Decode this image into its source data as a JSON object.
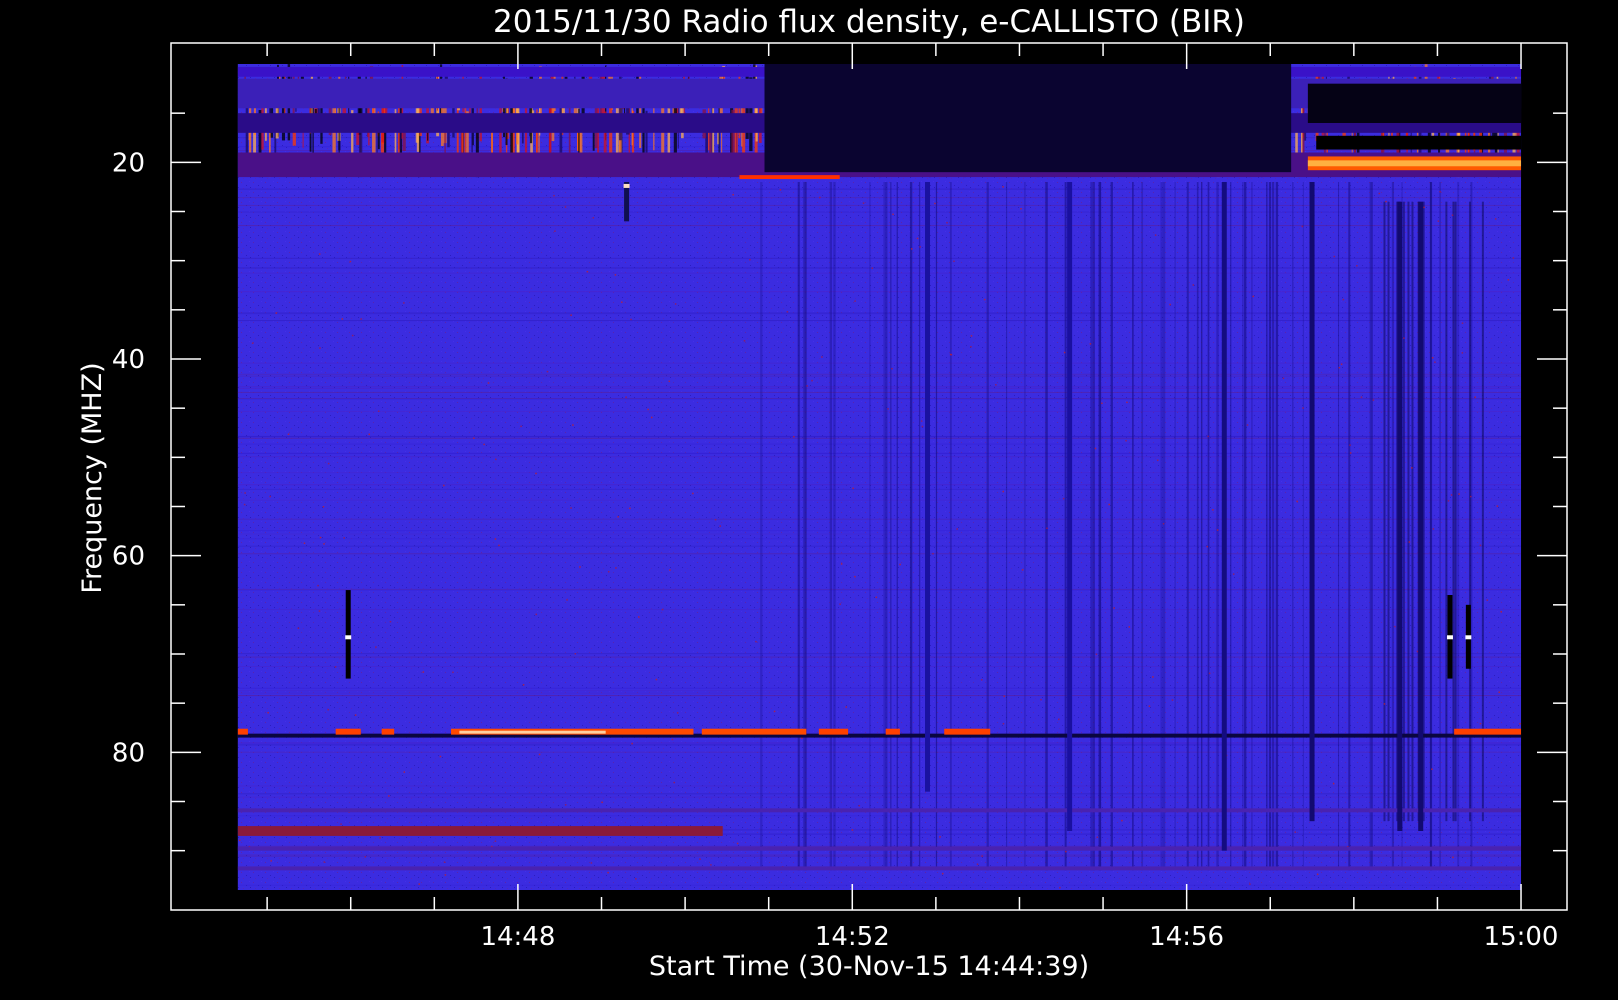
{
  "chart_data": {
    "type": "heatmap",
    "title": "2015/11/30  Radio flux density, e-CALLISTO (BIR)",
    "xlabel": "Start Time (30-Nov-15 14:44:39)",
    "ylabel": "Frequency (MHZ)",
    "x_tick_labels": [
      "14:48",
      "14:52",
      "14:56",
      "15:00"
    ],
    "x_tick_minutes": [
      3.35,
      7.35,
      11.35,
      15.35
    ],
    "x_range_minutes": [
      -0.8,
      15.9
    ],
    "data_x_range_minutes": [
      0,
      15.35
    ],
    "y_tick_values": [
      20,
      40,
      60,
      80
    ],
    "y_range": [
      10,
      94
    ],
    "data_y_range": [
      10,
      94
    ],
    "y_inverted": true,
    "colormap": "blue-red-yellow-white",
    "features": [
      {
        "kind": "hband",
        "f1": 10.3,
        "f2": 11.3,
        "t1": 0,
        "t2": 15.35,
        "color": "#3a12c8"
      },
      {
        "kind": "hband",
        "f1": 11.5,
        "f2": 14.5,
        "t1": 0,
        "t2": 15.35,
        "color": "#3b20b8"
      },
      {
        "kind": "hband",
        "f1": 15.0,
        "f2": 17.0,
        "t1": 0,
        "t2": 15.35,
        "color": "#2a0c88"
      },
      {
        "kind": "hband",
        "f1": 19.0,
        "f2": 21.5,
        "t1": 0,
        "t2": 15.35,
        "color": "#4a1088"
      },
      {
        "kind": "hband",
        "f1": 10.0,
        "f2": 21.0,
        "t1": 6.3,
        "t2": 12.6,
        "color": "#0a0430"
      },
      {
        "kind": "hband",
        "f1": 12.0,
        "f2": 16.0,
        "t1": 12.8,
        "t2": 15.35,
        "color": "#050215"
      },
      {
        "kind": "hband",
        "f1": 17.3,
        "f2": 18.7,
        "t1": 12.9,
        "t2": 15.35,
        "color": "#000000"
      },
      {
        "kind": "hband",
        "f1": 19.4,
        "f2": 20.8,
        "t1": 12.8,
        "t2": 15.35,
        "color": "#ff5a00"
      },
      {
        "kind": "hband",
        "f1": 19.8,
        "f2": 20.4,
        "t1": 12.8,
        "t2": 15.35,
        "color": "#ffb040"
      },
      {
        "kind": "hband",
        "f1": 21.3,
        "f2": 21.7,
        "t1": 6.0,
        "t2": 7.2,
        "color": "#ff3000"
      },
      {
        "kind": "hband",
        "f1": 87.5,
        "f2": 88.5,
        "t1": 0,
        "t2": 5.8,
        "color": "#8a1a3a"
      },
      {
        "kind": "hband",
        "f1": 85.7,
        "f2": 86.1,
        "t1": 0,
        "t2": 15.35,
        "color": "#4a22b0"
      },
      {
        "kind": "hband",
        "f1": 89.6,
        "f2": 90.0,
        "t1": 0,
        "t2": 15.35,
        "color": "#4a22b0"
      },
      {
        "kind": "hband",
        "f1": 91.6,
        "f2": 92.0,
        "t1": 0,
        "t2": 15.35,
        "color": "#4a22b0"
      },
      {
        "kind": "hband",
        "f1": 78.1,
        "f2": 78.5,
        "t1": 0,
        "t2": 15.35,
        "color": "#0a0640"
      },
      {
        "kind": "hband",
        "f1": 77.6,
        "f2": 78.2,
        "t1": 0,
        "t2": 0.12,
        "color": "#ff4000"
      },
      {
        "kind": "hband",
        "f1": 77.6,
        "f2": 78.2,
        "t1": 1.17,
        "t2": 1.47,
        "color": "#ff4000"
      },
      {
        "kind": "hband",
        "f1": 77.6,
        "f2": 78.2,
        "t1": 1.72,
        "t2": 1.87,
        "color": "#ff4000"
      },
      {
        "kind": "hband",
        "f1": 77.6,
        "f2": 78.2,
        "t1": 2.55,
        "t2": 5.45,
        "color": "#ff4a00"
      },
      {
        "kind": "hband",
        "f1": 77.8,
        "f2": 78.1,
        "t1": 2.65,
        "t2": 4.4,
        "color": "#ffd0a0"
      },
      {
        "kind": "hband",
        "f1": 77.6,
        "f2": 78.2,
        "t1": 5.55,
        "t2": 6.8,
        "color": "#ff4a00"
      },
      {
        "kind": "hband",
        "f1": 77.6,
        "f2": 78.2,
        "t1": 6.95,
        "t2": 7.3,
        "color": "#ff4000"
      },
      {
        "kind": "hband",
        "f1": 77.6,
        "f2": 78.2,
        "t1": 7.75,
        "t2": 7.92,
        "color": "#ff4000"
      },
      {
        "kind": "hband",
        "f1": 77.6,
        "f2": 78.2,
        "t1": 8.45,
        "t2": 9.0,
        "color": "#ff4000"
      },
      {
        "kind": "hband",
        "f1": 77.6,
        "f2": 78.2,
        "t1": 14.55,
        "t2": 15.35,
        "color": "#ff4000"
      },
      {
        "kind": "vline",
        "t": 1.32,
        "f1": 63.5,
        "f2": 72.5,
        "color": "#000000"
      },
      {
        "kind": "vline",
        "t": 14.5,
        "f1": 64.0,
        "f2": 72.5,
        "color": "#000000"
      },
      {
        "kind": "vline",
        "t": 14.72,
        "f1": 65.0,
        "f2": 71.5,
        "color": "#000000"
      },
      {
        "kind": "vline",
        "t": 4.65,
        "f1": 22.0,
        "f2": 26.0,
        "color": "#101050"
      },
      {
        "kind": "vline",
        "t": 8.25,
        "f1": 22.0,
        "f2": 84.0,
        "color": "#1a12a0"
      },
      {
        "kind": "vline",
        "t": 9.95,
        "f1": 22.0,
        "f2": 88.0,
        "color": "#1a10a0"
      },
      {
        "kind": "vline",
        "t": 11.8,
        "f1": 22.0,
        "f2": 90.0,
        "color": "#140c80"
      },
      {
        "kind": "vline",
        "t": 12.85,
        "f1": 22.0,
        "f2": 87.0,
        "color": "#120a70"
      },
      {
        "kind": "vline",
        "t": 13.9,
        "f1": 24.0,
        "f2": 88.0,
        "color": "#120a70"
      },
      {
        "kind": "vline",
        "t": 14.15,
        "f1": 24.0,
        "f2": 88.0,
        "color": "#120a70"
      },
      {
        "kind": "dot",
        "t": 1.32,
        "f": 68.3,
        "color": "#ffffff"
      },
      {
        "kind": "dot",
        "t": 14.5,
        "f": 68.3,
        "color": "#ffffff"
      },
      {
        "kind": "dot",
        "t": 14.72,
        "f": 68.3,
        "color": "#ffffff"
      },
      {
        "kind": "dot",
        "t": 4.65,
        "f": 22.4,
        "color": "#ffe0c0"
      }
    ]
  }
}
